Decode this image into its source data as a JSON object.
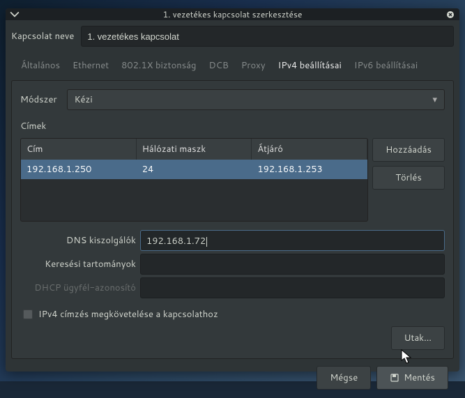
{
  "title": "1. vezetékes kapcsolat szerkesztése",
  "name_label": "Kapcsolat neve",
  "name_value": "1. vezetékes kapcsolat",
  "tabs": {
    "general": "Általános",
    "ethernet": "Ethernet",
    "security": "802.1X biztonság",
    "dcb": "DCB",
    "proxy": "Proxy",
    "ipv4": "IPv4 beállításai",
    "ipv6": "IPv6 beállításai"
  },
  "ipv4": {
    "method_label": "Módszer",
    "method_value": "Kézi",
    "addresses_label": "Címek",
    "headers": {
      "address": "Cím",
      "netmask": "Hálózati maszk",
      "gateway": "Átjáró"
    },
    "rows": [
      {
        "address": "192.168.1.250",
        "netmask": "24",
        "gateway": "192.168.1.253"
      }
    ],
    "add_button": "Hozzáadás",
    "delete_button": "Törlés",
    "dns_label": "DNS kiszolgálók",
    "dns_value": "192.168.1.72",
    "search_label": "Keresési tartományok",
    "search_value": "",
    "dhcp_label": "DHCP ügyfél-azonosító",
    "dhcp_value": "",
    "require_label": "IPv4 címzés megkövetelése a kapcsolathoz",
    "routes_button": "Utak…"
  },
  "footer": {
    "cancel": "Mégse",
    "save": "Mentés"
  }
}
